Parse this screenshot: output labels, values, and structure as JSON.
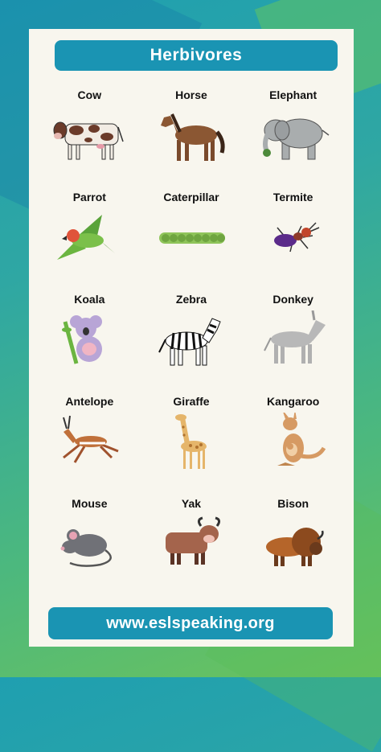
{
  "title": "Herbivores",
  "footer": "www.eslspeaking.org",
  "animals": [
    {
      "label": "Cow",
      "icon": "cow-icon"
    },
    {
      "label": "Horse",
      "icon": "horse-icon"
    },
    {
      "label": "Elephant",
      "icon": "elephant-icon"
    },
    {
      "label": "Parrot",
      "icon": "parrot-icon"
    },
    {
      "label": "Caterpillar",
      "icon": "caterpillar-icon"
    },
    {
      "label": "Termite",
      "icon": "termite-icon"
    },
    {
      "label": "Koala",
      "icon": "koala-icon"
    },
    {
      "label": "Zebra",
      "icon": "zebra-icon"
    },
    {
      "label": "Donkey",
      "icon": "donkey-icon"
    },
    {
      "label": "Antelope",
      "icon": "antelope-icon"
    },
    {
      "label": "Giraffe",
      "icon": "giraffe-icon"
    },
    {
      "label": "Kangaroo",
      "icon": "kangaroo-icon"
    },
    {
      "label": "Mouse",
      "icon": "mouse-icon"
    },
    {
      "label": "Yak",
      "icon": "yak-icon"
    },
    {
      "label": "Bison",
      "icon": "bison-icon"
    }
  ],
  "colors": {
    "banner": "#1a94b3",
    "card": "#f8f6ee",
    "bg_start": "#1f9fb0",
    "bg_end": "#6cc35c"
  }
}
